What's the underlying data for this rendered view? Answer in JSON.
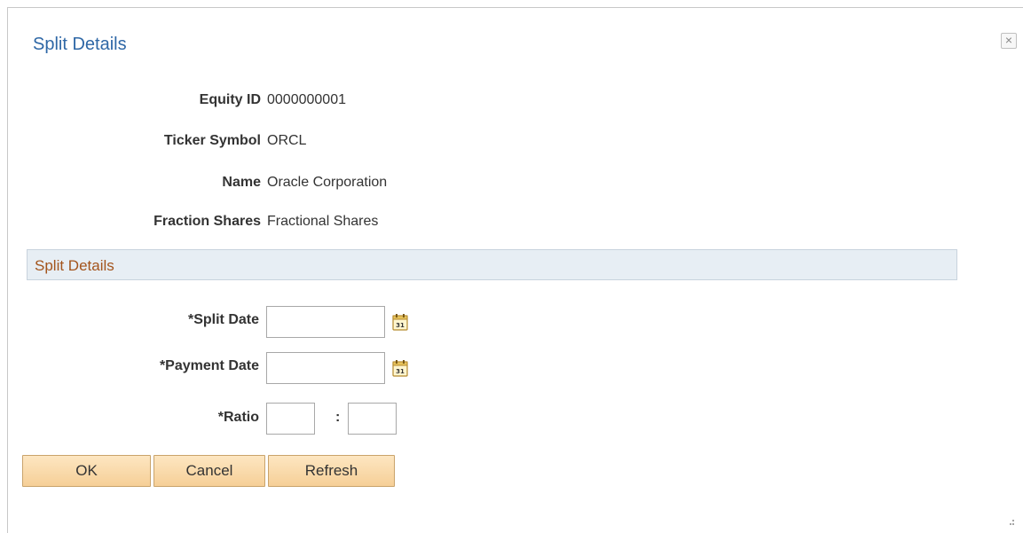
{
  "dialog": {
    "title": "Split Details",
    "close_glyph": "×"
  },
  "info": {
    "equity_id": {
      "label": "Equity ID",
      "value": "0000000001"
    },
    "ticker_symbol": {
      "label": "Ticker Symbol",
      "value": "ORCL"
    },
    "name": {
      "label": "Name",
      "value": "Oracle Corporation"
    },
    "fraction_shares": {
      "label": "Fraction Shares",
      "value": "Fractional Shares"
    }
  },
  "section": {
    "title": "Split Details"
  },
  "form": {
    "split_date": {
      "label": "*Split Date",
      "value": ""
    },
    "payment_date": {
      "label": "*Payment Date",
      "value": ""
    },
    "ratio": {
      "label": "*Ratio",
      "left_value": "",
      "separator": ":",
      "right_value": ""
    },
    "calendar_icon_text": "31"
  },
  "buttons": {
    "ok": "OK",
    "cancel": "Cancel",
    "refresh": "Refresh"
  },
  "colors": {
    "title_blue": "#2e67a6",
    "section_title_brown": "#a3541c",
    "section_bg": "#e7eef4",
    "button_bg": "#f6cf97"
  },
  "icons": {
    "close": "close-icon",
    "calendar": "calendar-icon",
    "resize": "resize-grip-icon"
  }
}
